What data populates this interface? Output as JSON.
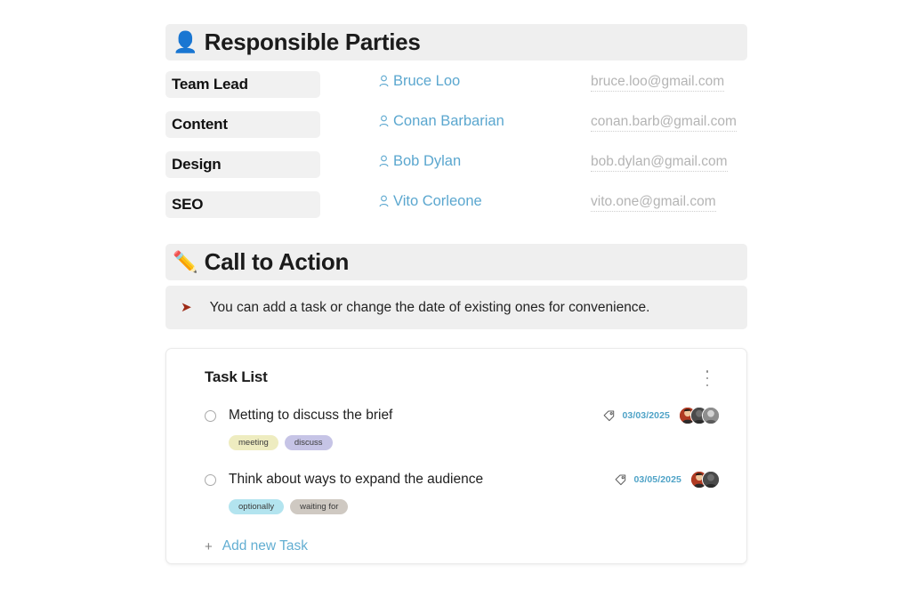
{
  "sections": {
    "parties": {
      "icon": "bust-in-silhouette-emoji",
      "icon_glyph": "👤",
      "title": "Responsible Parties",
      "rows": [
        {
          "role": "Team Lead",
          "name": "Bruce Loo",
          "email": "bruce.loo@gmail.com"
        },
        {
          "role": "Content",
          "name": "Conan Barbarian",
          "email": "conan.barb@gmail.com"
        },
        {
          "role": "Design",
          "name": "Bob Dylan",
          "email": "bob.dylan@gmail.com"
        },
        {
          "role": "SEO",
          "name": "Vito Corleone",
          "email": "vito.one@gmail.com"
        }
      ]
    },
    "cta": {
      "icon": "pencil-emoji",
      "icon_glyph": "✏️",
      "title": "Call to Action",
      "callout_bullet": "➤",
      "callout_text": "You can add a task or change the date of existing ones for convenience."
    }
  },
  "task_card": {
    "title": "Task List",
    "menu_label": "more-options",
    "tasks": [
      {
        "name": "Metting to discuss the brief",
        "date": "03/03/2025",
        "checked": false,
        "tags": [
          {
            "label": "meeting",
            "color": "#eeecc0"
          },
          {
            "label": "discuss",
            "color": "#c6c4e6"
          }
        ],
        "avatar_count": 3,
        "avatar_colors": [
          "#8d2f22",
          "#3f3f3f",
          "#6b6b6b"
        ]
      },
      {
        "name": "Think about ways to expand the audience",
        "date": "03/05/2025",
        "checked": false,
        "tags": [
          {
            "label": "optionally",
            "color": "#b3e4ef"
          },
          {
            "label": "waiting for",
            "color": "#cfc9c2"
          }
        ],
        "avatar_count": 2,
        "avatar_colors": [
          "#8d2f22",
          "#3f3f3f"
        ]
      }
    ],
    "add_task_label": "Add new Task",
    "add_task_plus": "+"
  },
  "colors": {
    "section_bar": "#efefef",
    "role_chip": "#f1f1f1",
    "link_blue": "#5ba7cf",
    "date_blue": "#4fa3c7",
    "email_gray": "#b4b4b4",
    "flag_red": "#9e2b17"
  }
}
